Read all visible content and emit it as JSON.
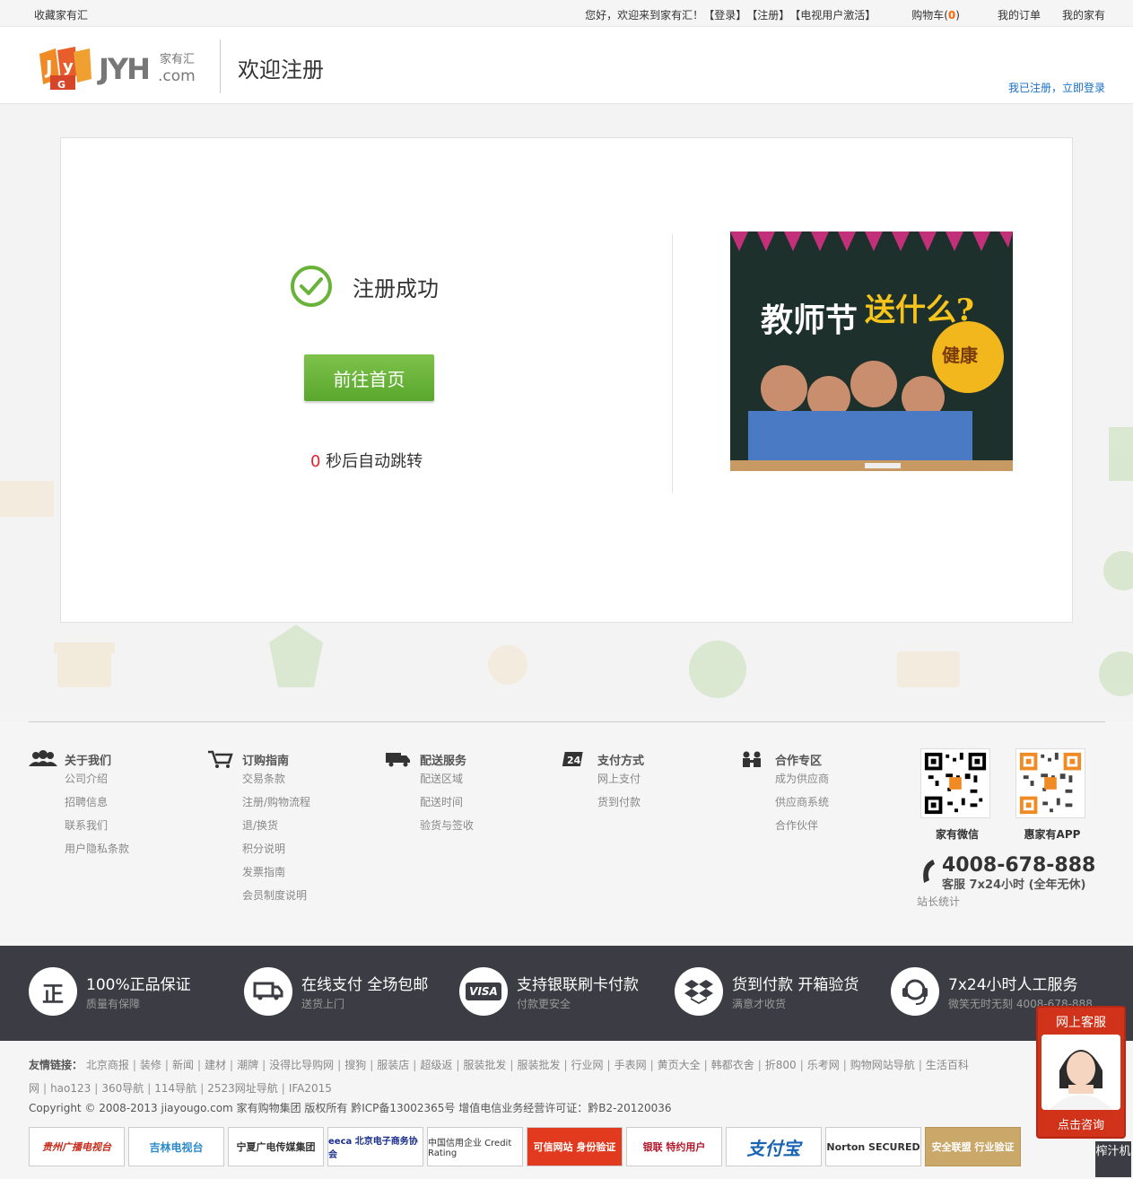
{
  "topbar": {
    "favorite": "收藏家有汇",
    "greeting": "您好，欢迎来到家有汇！",
    "login": "【登录】",
    "register": "【注册】",
    "tv_activate": "【电视用户激活】",
    "cart_label": "购物车(",
    "cart_count": "0",
    "cart_close": ")",
    "my_orders": "我的订单",
    "my_home": "我的家有"
  },
  "header": {
    "logo_text": "JYH.com",
    "logo_cn": "家有汇",
    "title": "欢迎注册",
    "login_link": "我已注册，立即登录"
  },
  "main": {
    "success_text": "注册成功",
    "home_button": "前往首页",
    "countdown_num": "0",
    "countdown_text": " 秒后自动跳转",
    "promo": {
      "title_1": "教师节",
      "title_2": "送什么?",
      "tag": "健康"
    }
  },
  "footer_columns": [
    {
      "title": "关于我们",
      "icon": "people-icon",
      "items": [
        "公司介绍",
        "招聘信息",
        "联系我们",
        "用户隐私条款"
      ]
    },
    {
      "title": "订购指南",
      "icon": "cart-icon",
      "items": [
        "交易条款",
        "注册/购物流程",
        "退/换货",
        "积分说明",
        "发票指南",
        "会员制度说明"
      ]
    },
    {
      "title": "配送服务",
      "icon": "truck-icon",
      "items": [
        "配送区域",
        "配送时间",
        "验货与签收"
      ]
    },
    {
      "title": "支付方式",
      "icon": "24h-icon",
      "items": [
        "网上支付",
        "货到付款"
      ]
    },
    {
      "title": "合作专区",
      "icon": "partner-icon",
      "items": [
        "成为供应商",
        "供应商系统",
        "合作伙伴"
      ]
    }
  ],
  "qr": {
    "wechat_label": "家有微信",
    "app_label": "惠家有APP"
  },
  "hotline": {
    "phone": "4008-678-888",
    "service": "客服 7x24小时 (全年无休)",
    "stats": "站长统计"
  },
  "band": [
    {
      "icon": "正",
      "title": "100%正品保证",
      "sub": "质量有保障"
    },
    {
      "icon": "truck",
      "title": "在线支付 全场包邮",
      "sub": "送货上门"
    },
    {
      "icon": "VISA",
      "title": "支持银联刷卡付款",
      "sub": "付款更安全"
    },
    {
      "icon": "box",
      "title": "货到付款 开箱验货",
      "sub": "满意才收货"
    },
    {
      "icon": "headset",
      "title": "7x24小时人工服务",
      "sub": "微笑无时无刻 4008-678-888"
    }
  ],
  "friends": {
    "label": "友情链接：",
    "links": [
      "北京商报",
      "装修",
      "新闻",
      "建材",
      "潮牌",
      "没得比导购网",
      "搜狗",
      "服装店",
      "超级返",
      "服装批发",
      "服装批发",
      "行业网",
      "手表网",
      "黄页大全",
      "韩都衣舍",
      "折800",
      "乐考网",
      "购物网站导航",
      "生活百科网",
      "hao123",
      "360导航",
      "114导航",
      "2523网址导航",
      "IFA2015"
    ]
  },
  "copyright": "Copyright © 2008-2013 jiayougo.com 家有购物集团 版权所有 黔ICP备13002365号 增值电信业务经营许可证：黔B2-20120036",
  "badges": [
    "贵州广播电视台",
    "吉林电视台",
    "宁夏广电传媒集团",
    "eeca 北京电子商务协会",
    "中国信用企业 Credit Rating",
    "可信网站 身份验证",
    "银联 特约用户",
    "支付宝",
    "Norton SECURED",
    "安全联盟 行业验证"
  ],
  "float": {
    "title": "网上客服",
    "button": "点击咨询"
  },
  "juicer": "榨汁机",
  "colors": {
    "accent_green": "#6ab33a",
    "dark_band": "#3c3d44",
    "link_blue": "#1a6fc4",
    "countdown_red": "#e3212f",
    "service_red": "#d0321a"
  }
}
